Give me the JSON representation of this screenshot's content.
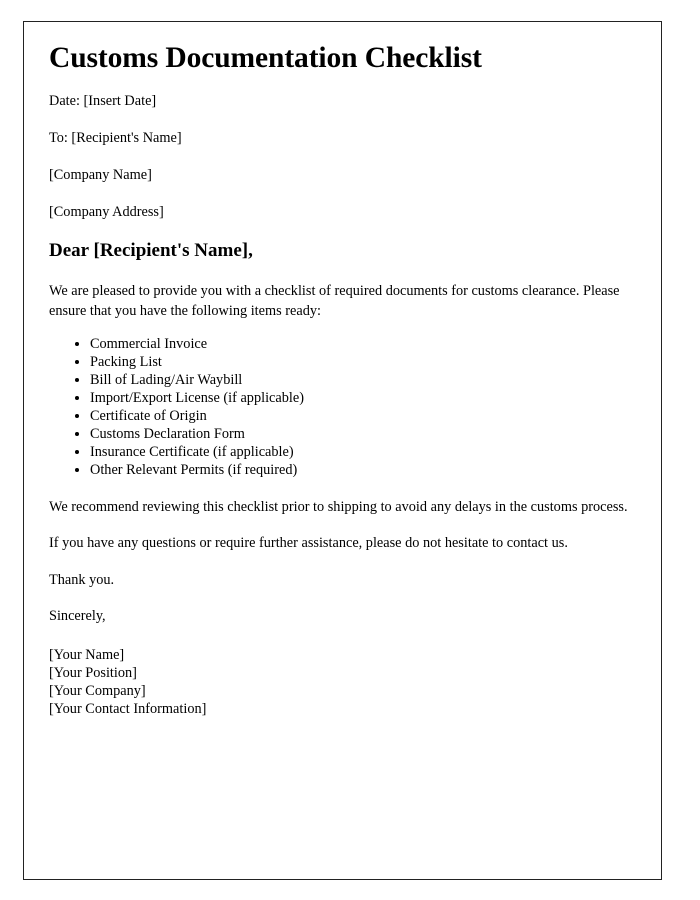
{
  "document": {
    "title": "Customs Documentation Checklist",
    "meta_lines": [
      "Date: [Insert Date]",
      "To: [Recipient's Name]",
      "[Company Name]",
      "[Company Address]"
    ],
    "salutation": "Dear [Recipient's Name],",
    "intro_paragraph": "We are pleased to provide you with a checklist of required documents for customs clearance. Please ensure that you have the following items ready:",
    "checklist_items": [
      "Commercial Invoice",
      "Packing List",
      "Bill of Lading/Air Waybill",
      "Import/Export License (if applicable)",
      "Certificate of Origin",
      "Customs Declaration Form",
      "Insurance Certificate (if applicable)",
      "Other Relevant Permits (if required)"
    ],
    "recommendation_paragraph": "We recommend reviewing this checklist prior to shipping to avoid any delays in the customs process.",
    "assistance_paragraph": "If you have any questions or require further assistance, please do not hesitate to contact us.",
    "thanks": "Thank you.",
    "closing": "Sincerely,",
    "signature_lines": [
      "[Your Name]",
      "[Your Position]",
      "[Your Company]",
      "[Your Contact Information]"
    ]
  },
  "style": {
    "page_background": "#ffffff",
    "border_color": "#222222",
    "text_color": "#000000"
  }
}
